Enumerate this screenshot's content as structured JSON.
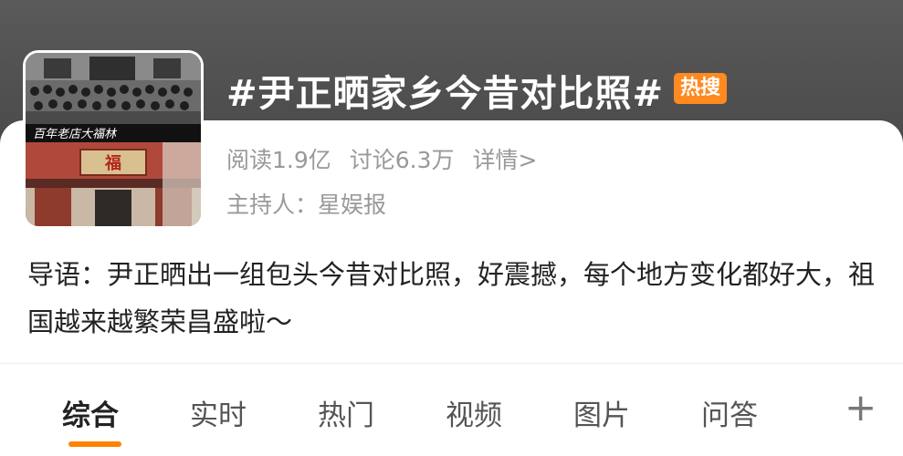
{
  "topic": {
    "title": "#尹正晒家乡今昔对比照#",
    "hot_badge": "热搜",
    "cover_caption": "百年老店大福林",
    "cover_sign": "福"
  },
  "stats": {
    "read": "阅读1.9亿",
    "discuss": "讨论6.3万",
    "details": "详情>"
  },
  "host": "主持人：星娱报",
  "intro": "导语：尹正晒出一组包头今昔对比照，好震撼，每个地方变化都好大，祖国越来越繁荣昌盛啦～",
  "tabs": [
    "综合",
    "实时",
    "热门",
    "视频",
    "图片",
    "问答"
  ],
  "tab_plus": "+",
  "colors": {
    "accent": "#ff8200",
    "hot_badge": "#ff8a1f",
    "muted_text": "#999999"
  }
}
